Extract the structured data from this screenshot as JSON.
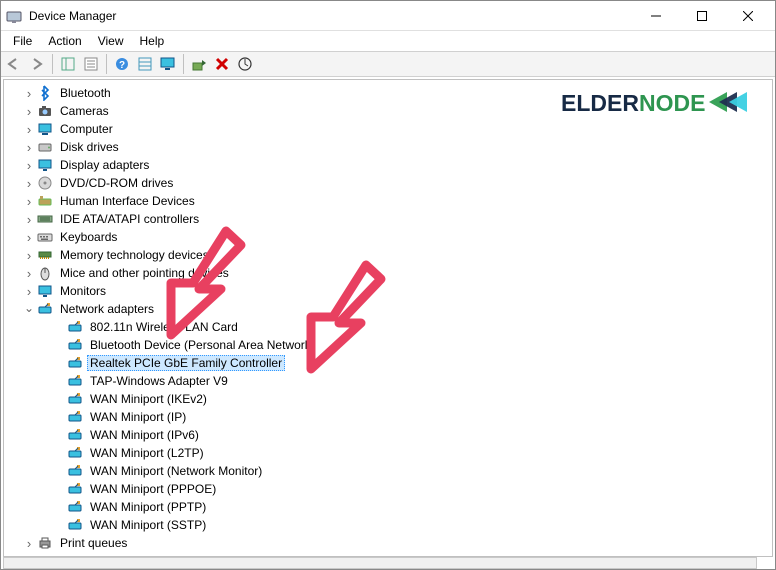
{
  "window": {
    "title": "Device Manager"
  },
  "menubar": [
    "File",
    "Action",
    "View",
    "Help"
  ],
  "toolbar": {
    "items": [
      "back-icon",
      "forward-icon",
      "sep",
      "show-hidden-icon",
      "properties-icon",
      "sep",
      "help-icon",
      "list-icon",
      "monitor-icon",
      "sep",
      "update-driver-icon",
      "uninstall-icon",
      "scan-icon"
    ],
    "uninstall_color": "#d00000"
  },
  "tree": [
    {
      "label": "Bluetooth",
      "icon": "bluetooth-icon",
      "depth": 1,
      "expand": "col"
    },
    {
      "label": "Cameras",
      "icon": "camera-icon",
      "depth": 1,
      "expand": "col"
    },
    {
      "label": "Computer",
      "icon": "computer-icon",
      "depth": 1,
      "expand": "col"
    },
    {
      "label": "Disk drives",
      "icon": "disk-icon",
      "depth": 1,
      "expand": "col"
    },
    {
      "label": "Display adapters",
      "icon": "display-icon",
      "depth": 1,
      "expand": "col"
    },
    {
      "label": "DVD/CD-ROM drives",
      "icon": "optical-icon",
      "depth": 1,
      "expand": "col"
    },
    {
      "label": "Human Interface Devices",
      "icon": "hid-icon",
      "depth": 1,
      "expand": "col"
    },
    {
      "label": "IDE ATA/ATAPI controllers",
      "icon": "ide-icon",
      "depth": 1,
      "expand": "col"
    },
    {
      "label": "Keyboards",
      "icon": "keyboard-icon",
      "depth": 1,
      "expand": "col"
    },
    {
      "label": "Memory technology devices",
      "icon": "memory-icon",
      "depth": 1,
      "expand": "col"
    },
    {
      "label": "Mice and other pointing devices",
      "icon": "mouse-icon",
      "depth": 1,
      "expand": "col"
    },
    {
      "label": "Monitors",
      "icon": "monitor-cat-icon",
      "depth": 1,
      "expand": "col"
    },
    {
      "label": "Network adapters",
      "icon": "network-icon",
      "depth": 1,
      "expand": "exp"
    },
    {
      "label": "802.11n Wireless LAN Card",
      "icon": "nic-icon",
      "depth": 2
    },
    {
      "label": "Bluetooth Device (Personal Area Network)",
      "icon": "nic-icon",
      "depth": 2
    },
    {
      "label": "Realtek PCIe GbE Family Controller",
      "icon": "nic-icon",
      "depth": 2,
      "selected": true
    },
    {
      "label": "TAP-Windows Adapter V9",
      "icon": "nic-icon",
      "depth": 2
    },
    {
      "label": "WAN Miniport (IKEv2)",
      "icon": "nic-icon",
      "depth": 2
    },
    {
      "label": "WAN Miniport (IP)",
      "icon": "nic-icon",
      "depth": 2
    },
    {
      "label": "WAN Miniport (IPv6)",
      "icon": "nic-icon",
      "depth": 2
    },
    {
      "label": "WAN Miniport (L2TP)",
      "icon": "nic-icon",
      "depth": 2
    },
    {
      "label": "WAN Miniport (Network Monitor)",
      "icon": "nic-icon",
      "depth": 2
    },
    {
      "label": "WAN Miniport (PPPOE)",
      "icon": "nic-icon",
      "depth": 2
    },
    {
      "label": "WAN Miniport (PPTP)",
      "icon": "nic-icon",
      "depth": 2
    },
    {
      "label": "WAN Miniport (SSTP)",
      "icon": "nic-icon",
      "depth": 2
    },
    {
      "label": "Print queues",
      "icon": "printer-icon",
      "depth": 1,
      "expand": "col"
    }
  ],
  "logo": {
    "text_a": "ELDER",
    "text_b": "NODE",
    "colors": {
      "a": "#172a45",
      "b": "#2e9550",
      "tri1": "#3aa35a",
      "tri2": "#1f2f50",
      "tri3": "#3acfe2"
    }
  },
  "annotation": {
    "color": "#e84060"
  }
}
